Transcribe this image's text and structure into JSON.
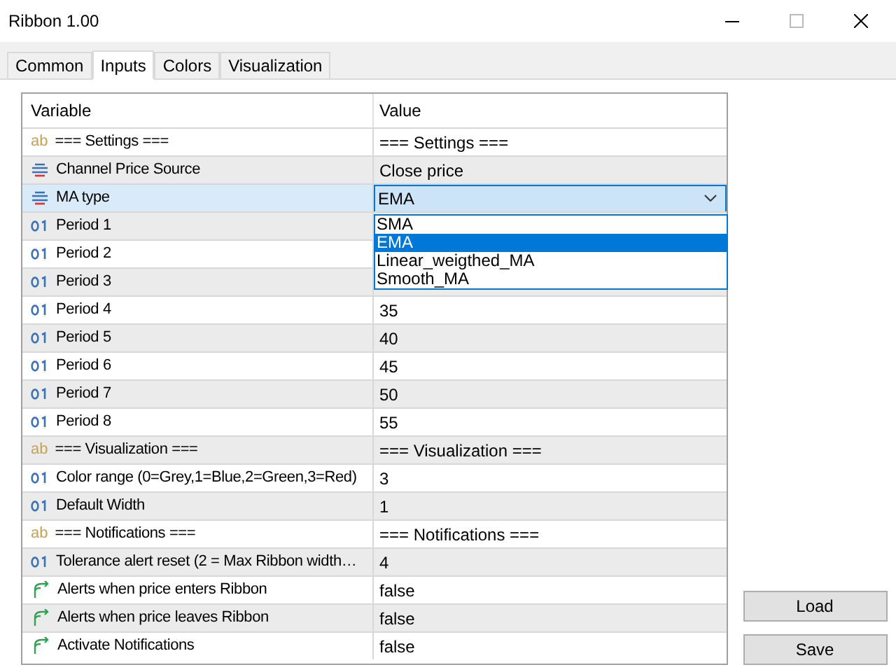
{
  "window": {
    "title": "Ribbon 1.00",
    "maximize_disabled": true
  },
  "tabs": [
    {
      "label": "Common",
      "selected": false
    },
    {
      "label": "Inputs",
      "selected": true
    },
    {
      "label": "Colors",
      "selected": false
    },
    {
      "label": "Visualization",
      "selected": false
    }
  ],
  "table": {
    "columns": [
      "Variable",
      "Value"
    ],
    "rows": [
      {
        "kind": "string",
        "icon": "ab",
        "variable": "=== Settings ===",
        "value": "=== Settings ===",
        "selected": false
      },
      {
        "kind": "enum",
        "variable": "Channel Price Source",
        "value": "Close price",
        "selected": false
      },
      {
        "kind": "enum",
        "variable": "MA type",
        "value": "EMA",
        "selected": true,
        "dropdown": [
          {
            "label": "SMA",
            "selected": false
          },
          {
            "label": "EMA",
            "selected": true
          },
          {
            "label": "Linear_weigthed_MA",
            "selected": false
          },
          {
            "label": "Smooth_MA",
            "selected": false
          }
        ]
      },
      {
        "kind": "int",
        "variable": "Period 1",
        "selected": false
      },
      {
        "kind": "int",
        "variable": "Period 2",
        "selected": false
      },
      {
        "kind": "int",
        "variable": "Period 3",
        "selected": false
      },
      {
        "kind": "int",
        "variable": "Period 4",
        "value": "35",
        "selected": false
      },
      {
        "kind": "int",
        "variable": "Period 5",
        "value": "40",
        "selected": false
      },
      {
        "kind": "int",
        "variable": "Period 6",
        "value": "45",
        "selected": false
      },
      {
        "kind": "int",
        "variable": "Period 7",
        "value": "50",
        "selected": false
      },
      {
        "kind": "int",
        "variable": "Period 8",
        "value": "55",
        "selected": false
      },
      {
        "kind": "string",
        "icon": "ab",
        "variable": "=== Visualization ===",
        "value": "=== Visualization ===",
        "selected": false
      },
      {
        "kind": "int",
        "variable": "Color range (0=Grey,1=Blue,2=Green,3=Red)",
        "value": "3",
        "selected": false
      },
      {
        "kind": "int",
        "variable": "Default Width",
        "value": "1",
        "selected": false
      },
      {
        "kind": "string",
        "icon": "ab",
        "variable": "=== Notifications ===",
        "value": "=== Notifications ===",
        "selected": false
      },
      {
        "kind": "int",
        "variable": "Tolerance alert reset (2 = Max Ribbon width…",
        "value": "4",
        "selected": false
      },
      {
        "kind": "bool",
        "variable": "Alerts when price enters Ribbon",
        "value": "false",
        "selected": false
      },
      {
        "kind": "bool",
        "variable": "Alerts when price leaves Ribbon",
        "value": "false",
        "selected": false
      },
      {
        "kind": "bool",
        "variable": "Activate Notifications",
        "value": "false",
        "selected": false
      }
    ]
  },
  "buttons": [
    "Load",
    "Save"
  ]
}
